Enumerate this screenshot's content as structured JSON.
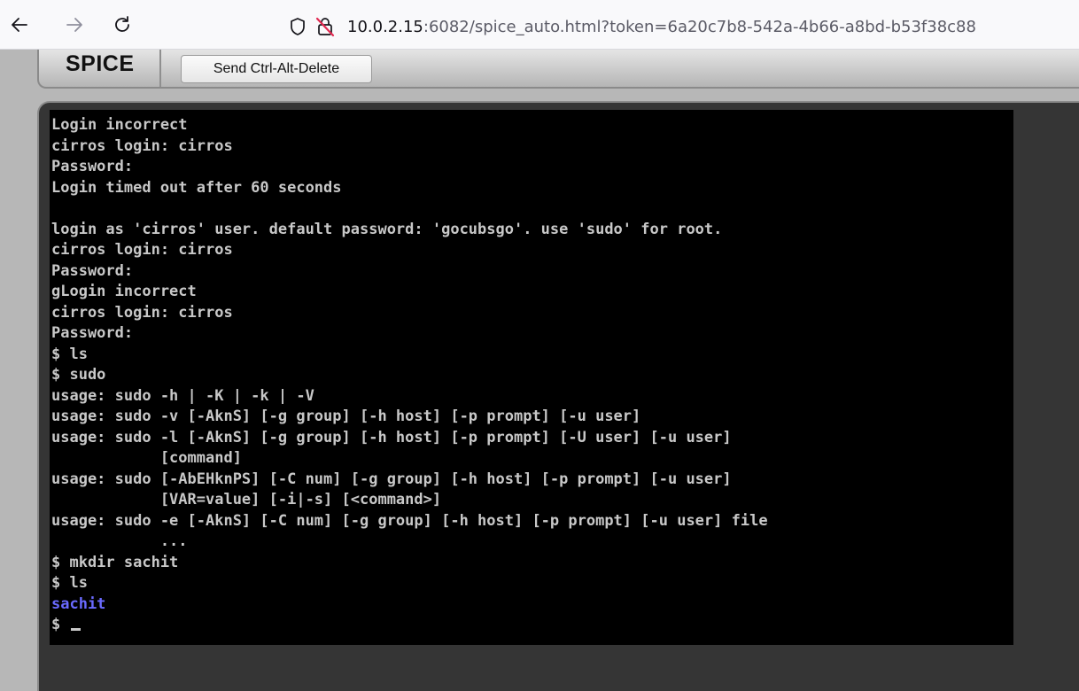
{
  "browser": {
    "url_host": "10.0.2.15",
    "url_rest": ":6082/spice_auto.html?token=6a20c7b8-542a-4b66-a8bd-b53f38c88"
  },
  "spice": {
    "logo": "SPICE",
    "ctrl_alt_delete_label": "Send Ctrl-Alt-Delete"
  },
  "terminal": {
    "lines": [
      {
        "text": "Login incorrect",
        "style": "normal"
      },
      {
        "text": "cirros login: cirros",
        "style": "normal"
      },
      {
        "text": "Password:",
        "style": "normal"
      },
      {
        "text": "Login timed out after 60 seconds",
        "style": "normal"
      },
      {
        "text": "",
        "style": "normal"
      },
      {
        "text": "login as 'cirros' user. default password: 'gocubsgo'. use 'sudo' for root.",
        "style": "normal"
      },
      {
        "text": "cirros login: cirros",
        "style": "normal"
      },
      {
        "text": "Password:",
        "style": "normal"
      },
      {
        "text": "gLogin incorrect",
        "style": "normal"
      },
      {
        "text": "cirros login: cirros",
        "style": "normal"
      },
      {
        "text": "Password:",
        "style": "normal"
      },
      {
        "text": "$ ls",
        "style": "normal"
      },
      {
        "text": "$ sudo",
        "style": "normal"
      },
      {
        "text": "usage: sudo -h | -K | -k | -V",
        "style": "normal"
      },
      {
        "text": "usage: sudo -v [-AknS] [-g group] [-h host] [-p prompt] [-u user]",
        "style": "normal"
      },
      {
        "text": "usage: sudo -l [-AknS] [-g group] [-h host] [-p prompt] [-U user] [-u user]",
        "style": "normal"
      },
      {
        "text": "            [command]",
        "style": "normal"
      },
      {
        "text": "usage: sudo [-AbEHknPS] [-C num] [-g group] [-h host] [-p prompt] [-u user]",
        "style": "normal"
      },
      {
        "text": "            [VAR=value] [-i|-s] [<command>]",
        "style": "normal"
      },
      {
        "text": "usage: sudo -e [-AknS] [-C num] [-g group] [-h host] [-p prompt] [-u user] file",
        "style": "normal"
      },
      {
        "text": "            ...",
        "style": "normal"
      },
      {
        "text": "$ mkdir sachit",
        "style": "normal"
      },
      {
        "text": "$ ls",
        "style": "normal"
      },
      {
        "text": "sachit",
        "style": "dir"
      },
      {
        "text": "$ ",
        "style": "prompt"
      }
    ]
  }
}
